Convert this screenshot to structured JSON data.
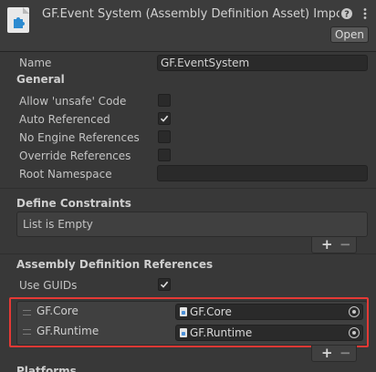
{
  "header": {
    "title": "GF.Event System (Assembly Definition Asset) Impor",
    "open_label": "Open",
    "icons": [
      "asset-file-icon",
      "help-icon",
      "settings-icon"
    ]
  },
  "name_field": {
    "label": "Name",
    "value": "GF.EventSystem"
  },
  "general": {
    "heading": "General",
    "allow_unsafe": {
      "label": "Allow 'unsafe' Code",
      "checked": false
    },
    "auto_referenced": {
      "label": "Auto Referenced",
      "checked": true
    },
    "no_engine_refs": {
      "label": "No Engine References",
      "checked": false
    },
    "override_refs": {
      "label": "Override References",
      "checked": false
    },
    "root_namespace": {
      "label": "Root Namespace",
      "value": ""
    }
  },
  "define_constraints": {
    "heading": "Define Constraints",
    "empty_text": "List is Empty",
    "add": "+",
    "remove": "−"
  },
  "assembly_refs": {
    "heading": "Assembly Definition References",
    "use_guids": {
      "label": "Use GUIDs",
      "checked": true
    },
    "items": [
      {
        "label": "GF.Core",
        "value": "GF.Core"
      },
      {
        "label": "GF.Runtime",
        "value": "GF.Runtime"
      }
    ],
    "add": "+",
    "remove": "−"
  },
  "next_section": {
    "heading": "Platforms"
  },
  "colors": {
    "highlight": "#e53935",
    "background": "#383838"
  }
}
